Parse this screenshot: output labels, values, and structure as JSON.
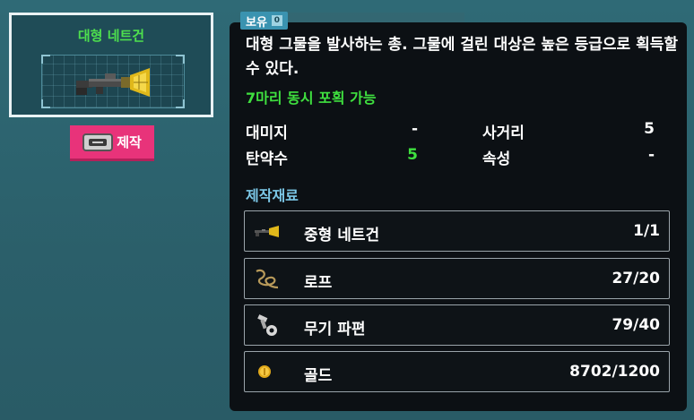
{
  "item": {
    "name": "대형 네트건"
  },
  "craft_button": {
    "label": "제작",
    "key_icon": "spacebar-key-icon"
  },
  "tooltip": {
    "owned_label": "보유",
    "owned_count": "0",
    "description": "대형 그물을 발사하는 총. 그물에 걸린 대상은 높은 등급으로 획득할 수 있다.",
    "capture_note": "7마리 동시 포획 가능",
    "stats": {
      "damage_label": "대미지",
      "damage_value": "-",
      "range_label": "사거리",
      "range_value": "5",
      "ammo_label": "탄약수",
      "ammo_value": "5",
      "element_label": "속성",
      "element_value": "-"
    },
    "materials_title": "제작재료",
    "materials": [
      {
        "name": "중형 네트건",
        "count": "1/1",
        "icon": "net-gun-icon"
      },
      {
        "name": "로프",
        "count": "27/20",
        "icon": "rope-icon"
      },
      {
        "name": "무기 파편",
        "count": "79/40",
        "icon": "weapon-fragment-icon"
      },
      {
        "name": "골드",
        "count": "8702/1200",
        "icon": "gold-coin-icon"
      }
    ]
  },
  "colors": {
    "item_name": "#4ee04e",
    "capture_note": "#3fe03f",
    "ammo_value": "#3fe03f",
    "materials_title": "#7cc8e8",
    "craft_button": "#e8337a",
    "owned_badge": "#3a93b0"
  }
}
